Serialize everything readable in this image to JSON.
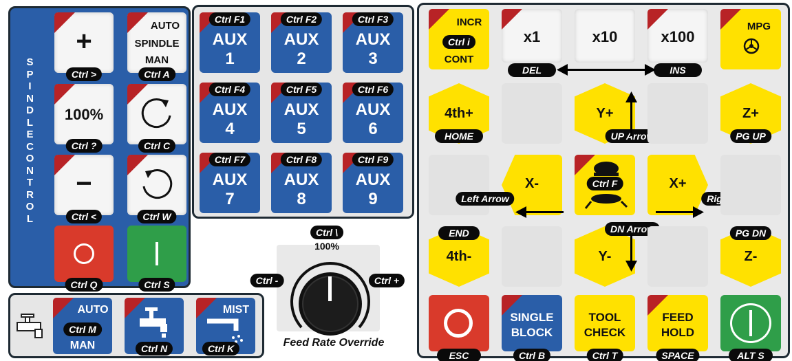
{
  "spindle": {
    "title": "SPINDLE CONTROL",
    "plus": {
      "symbol": "+",
      "shortcut": "Ctrl >"
    },
    "auto_man": {
      "top": "AUTO",
      "middle": "SPINDLE",
      "bottom": "MAN",
      "shortcut": "Ctrl A"
    },
    "percent": {
      "text": "100%",
      "shortcut": "Ctrl ?"
    },
    "cw": {
      "shortcut": "Ctrl C"
    },
    "minus": {
      "symbol": "−",
      "shortcut": "Ctrl <"
    },
    "ccw": {
      "shortcut": "Ctrl W"
    },
    "stop": {
      "shortcut": "Ctrl Q"
    },
    "start": {
      "shortcut": "Ctrl S"
    }
  },
  "coolant": {
    "auto_man": {
      "top": "AUTO",
      "bottom": "MAN",
      "shortcut": "Ctrl M"
    },
    "flood": {
      "shortcut": "Ctrl N"
    },
    "mist": {
      "label": "MIST",
      "shortcut": "Ctrl K"
    }
  },
  "aux": [
    {
      "label": "AUX",
      "num": "1",
      "shortcut": "Ctrl F1"
    },
    {
      "label": "AUX",
      "num": "2",
      "shortcut": "Ctrl F2"
    },
    {
      "label": "AUX",
      "num": "3",
      "shortcut": "Ctrl F3"
    },
    {
      "label": "AUX",
      "num": "4",
      "shortcut": "Ctrl F4"
    },
    {
      "label": "AUX",
      "num": "5",
      "shortcut": "Ctrl F5"
    },
    {
      "label": "AUX",
      "num": "6",
      "shortcut": "Ctrl F6"
    },
    {
      "label": "AUX",
      "num": "7",
      "shortcut": "Ctrl F7"
    },
    {
      "label": "AUX",
      "num": "8",
      "shortcut": "Ctrl F8"
    },
    {
      "label": "AUX",
      "num": "9",
      "shortcut": "Ctrl F9"
    }
  ],
  "feed": {
    "title": "Feed Rate Override",
    "top_shortcut": "Ctrl \\",
    "percent": "100%",
    "dec_shortcut": "Ctrl -",
    "inc_shortcut": "Ctrl +"
  },
  "jog": {
    "incr": {
      "top": "INCR",
      "shortcut": "Ctrl i",
      "bottom": "CONT"
    },
    "x1": {
      "label": "x1"
    },
    "x10": {
      "label": "x10"
    },
    "x100": {
      "label": "x100"
    },
    "del": "DEL",
    "ins": "INS",
    "mpg": {
      "label": "MPG"
    },
    "home": {
      "label": "4th+",
      "shortcut": "HOME"
    },
    "y_plus": {
      "label": "Y+",
      "shortcut": "UP Arrow"
    },
    "z_plus": {
      "label": "Z+",
      "shortcut": "PG UP"
    },
    "x_minus": {
      "label": "X-",
      "shortcut": "Left Arrow"
    },
    "rapid": {
      "shortcut": "Ctrl F"
    },
    "x_plus": {
      "label": "X+",
      "shortcut": "Right Arrow"
    },
    "fourth_minus": {
      "label": "4th-",
      "shortcut": "END"
    },
    "y_minus": {
      "label": "Y-",
      "shortcut": "DN Arrow"
    },
    "z_minus": {
      "label": "Z-",
      "shortcut": "PG DN"
    },
    "estop": {
      "shortcut": "ESC"
    },
    "single_block": {
      "line1": "SINGLE",
      "line2": "BLOCK",
      "shortcut": "Ctrl B"
    },
    "tool_check": {
      "line1": "TOOL",
      "line2": "CHECK",
      "shortcut": "Ctrl T"
    },
    "feed_hold": {
      "line1": "FEED",
      "line2": "HOLD",
      "shortcut": "SPACE"
    },
    "cycle_start": {
      "shortcut": "ALT S"
    }
  },
  "colors": {
    "blue": "#2a5ea8",
    "yellow": "#ffe100",
    "red": "#d93a2b",
    "green": "#2f9e49",
    "panel_bg": "#2a5ea8"
  }
}
